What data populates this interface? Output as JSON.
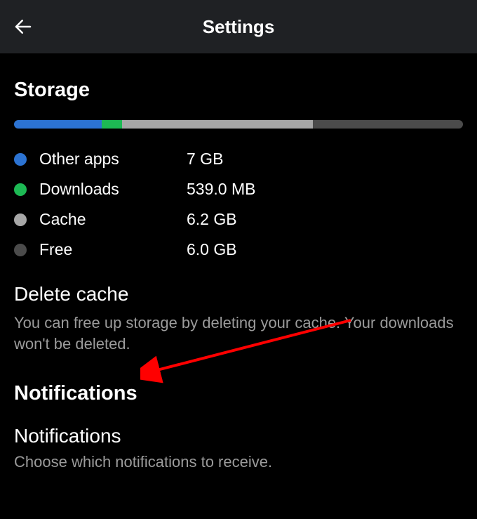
{
  "header": {
    "title": "Settings"
  },
  "storage": {
    "heading": "Storage",
    "bar": {
      "segments": [
        {
          "name": "other-apps",
          "color": "#2c73d2",
          "width": 19.5
        },
        {
          "name": "downloads",
          "color": "#1db954",
          "width": 4.5
        },
        {
          "name": "cache",
          "color": "#a7a7a7",
          "width": 42.5
        },
        {
          "name": "free",
          "color": "#4b4b4b",
          "width": 33.5
        }
      ]
    },
    "legend": [
      {
        "label": "Other apps",
        "value": "7 GB",
        "dot": "#2c73d2"
      },
      {
        "label": "Downloads",
        "value": "539.0 MB",
        "dot": "#1db954"
      },
      {
        "label": "Cache",
        "value": "6.2 GB",
        "dot": "#a7a7a7"
      },
      {
        "label": "Free",
        "value": "6.0 GB",
        "dot": "#4b4b4b"
      }
    ],
    "delete_cache": {
      "title": "Delete cache",
      "desc": "You can free up storage by deleting your cache. Your downloads won't be deleted."
    }
  },
  "notifications": {
    "heading": "Notifications",
    "item": {
      "title": "Notifications",
      "desc": "Choose which notifications to receive."
    }
  },
  "annotation": {
    "arrow_color": "#ff0000"
  }
}
